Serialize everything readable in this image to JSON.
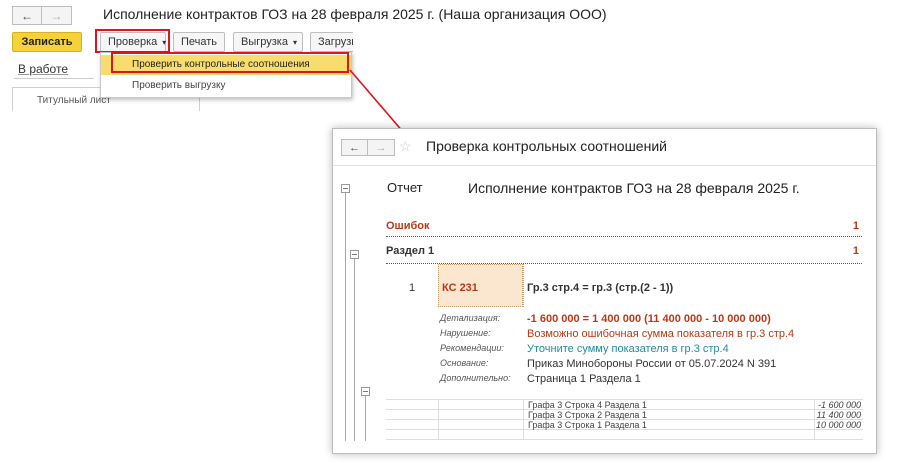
{
  "main_window": {
    "nav_back": "←",
    "nav_forward": "→",
    "title": "Исполнение контрактов ГОЗ на 28 февраля 2025 г. (Наша организация ООО)",
    "toolbar": {
      "save": "Записать",
      "check": "Проверка",
      "print": "Печать",
      "export": "Выгрузка",
      "load": "Загрузк",
      "caret": "▾"
    },
    "status_link": "В работе",
    "tab": "Титульный лист"
  },
  "dropdown": {
    "items": [
      "Проверить контрольные соотношения",
      "Проверить выгрузку"
    ]
  },
  "check_window": {
    "nav_back": "←",
    "nav_forward": "→",
    "star": "☆",
    "title": "Проверка контрольных соотношений",
    "report_label": "Отчет",
    "report_title": "Исполнение контрактов ГОЗ на 28 февраля 2025 г.",
    "errors_label": "Ошибок",
    "errors_count": "1",
    "section_label": "Раздел 1",
    "section_count": "1",
    "row_num": "1",
    "code": "КС 231",
    "formula": "Гр.3 стр.4 = гр.3 (стр.(2 - 1))",
    "details": [
      {
        "key": "Детализация:",
        "value": "-1 600 000 = 1 400 000 (11 400 000 - 10 000 000)"
      },
      {
        "key": "Нарушение:",
        "value": "Возможно ошибочная сумма показателя в гр.3 стр.4"
      },
      {
        "key": "Рекомендации:",
        "value": "Уточните сумму показателя в гр.3 стр.4"
      },
      {
        "key": "Основание:",
        "value": "Приказ Минобороны России от 05.07.2024 N 391"
      },
      {
        "key": "Дополнительно:",
        "value": "Страница 1 Раздела 1"
      }
    ],
    "rows": [
      {
        "label": "Графа 3 Строка 4 Раздела 1",
        "value": "-1 600 000"
      },
      {
        "label": "Графа 3 Строка 2 Раздела 1",
        "value": "11 400 000"
      },
      {
        "label": "Графа 3 Строка 1 Раздела 1",
        "value": "10 000 000"
      }
    ]
  },
  "colors": {
    "accent_yellow": "#f5d13a",
    "highlight_red": "#e0141e",
    "error_red": "#b73a16",
    "recommend_teal": "#1f8f9a"
  }
}
